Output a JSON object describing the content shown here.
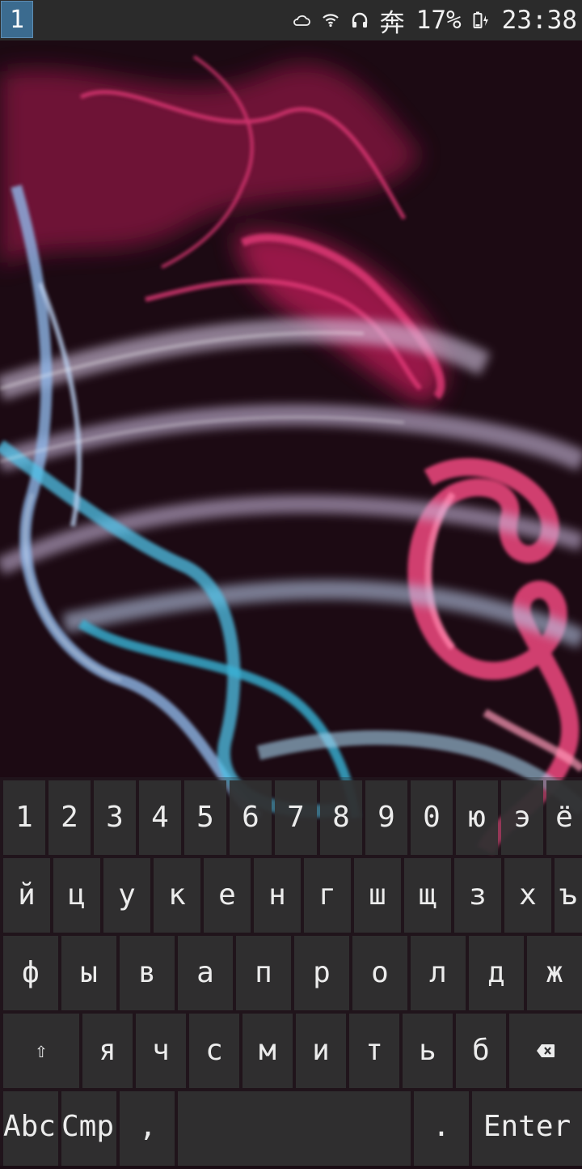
{
  "status_bar": {
    "workspace": "1",
    "icons": [
      "cloud-icon",
      "wifi-icon",
      "headphones-icon",
      "input-method-icon",
      "battery-icon"
    ],
    "input_method": "奔",
    "battery_percent": "17%",
    "time": "23:38"
  },
  "keyboard": {
    "row1": [
      "1",
      "2",
      "3",
      "4",
      "5",
      "6",
      "7",
      "8",
      "9",
      "0",
      "ю",
      "э",
      "ё"
    ],
    "row2": [
      "й",
      "ц",
      "у",
      "к",
      "е",
      "н",
      "г",
      "ш",
      "щ",
      "з",
      "х",
      "ъ"
    ],
    "row3": [
      "ф",
      "ы",
      "в",
      "а",
      "п",
      "р",
      "о",
      "л",
      "д",
      "ж"
    ],
    "row4": [
      "я",
      "ч",
      "с",
      "м",
      "и",
      "т",
      "ь",
      "б"
    ],
    "shift_symbol": "⇧",
    "backspace_icon": "backspace-icon",
    "abc": "Abc",
    "cmp": "Cmp",
    "comma": ",",
    "space": "",
    "period": ".",
    "enter": "Enter"
  }
}
